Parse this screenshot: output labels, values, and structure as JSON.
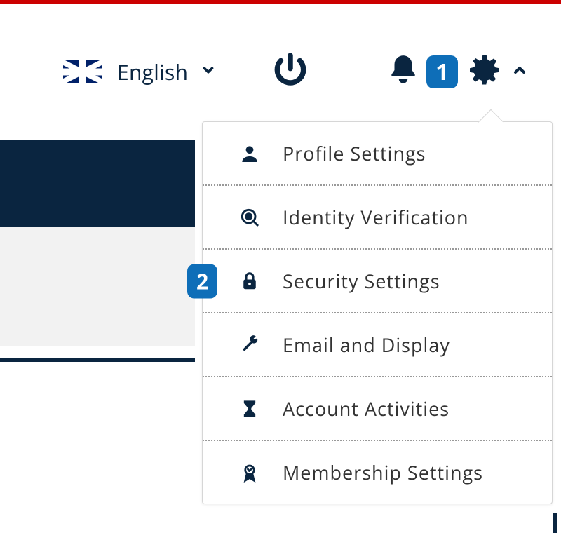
{
  "colors": {
    "accent_blue": "#0e6eb8",
    "dark_navy": "#0a2540",
    "top_bar_red": "#cc0000"
  },
  "header": {
    "language_label": "English",
    "notification_count": "1"
  },
  "callouts": {
    "header_settings_step": "1",
    "security_step": "2"
  },
  "menu": {
    "items": [
      {
        "label": "Profile Settings"
      },
      {
        "label": "Identity Verification"
      },
      {
        "label": "Security Settings"
      },
      {
        "label": "Email and Display"
      },
      {
        "label": "Account Activities"
      },
      {
        "label": "Membership Settings"
      }
    ]
  }
}
